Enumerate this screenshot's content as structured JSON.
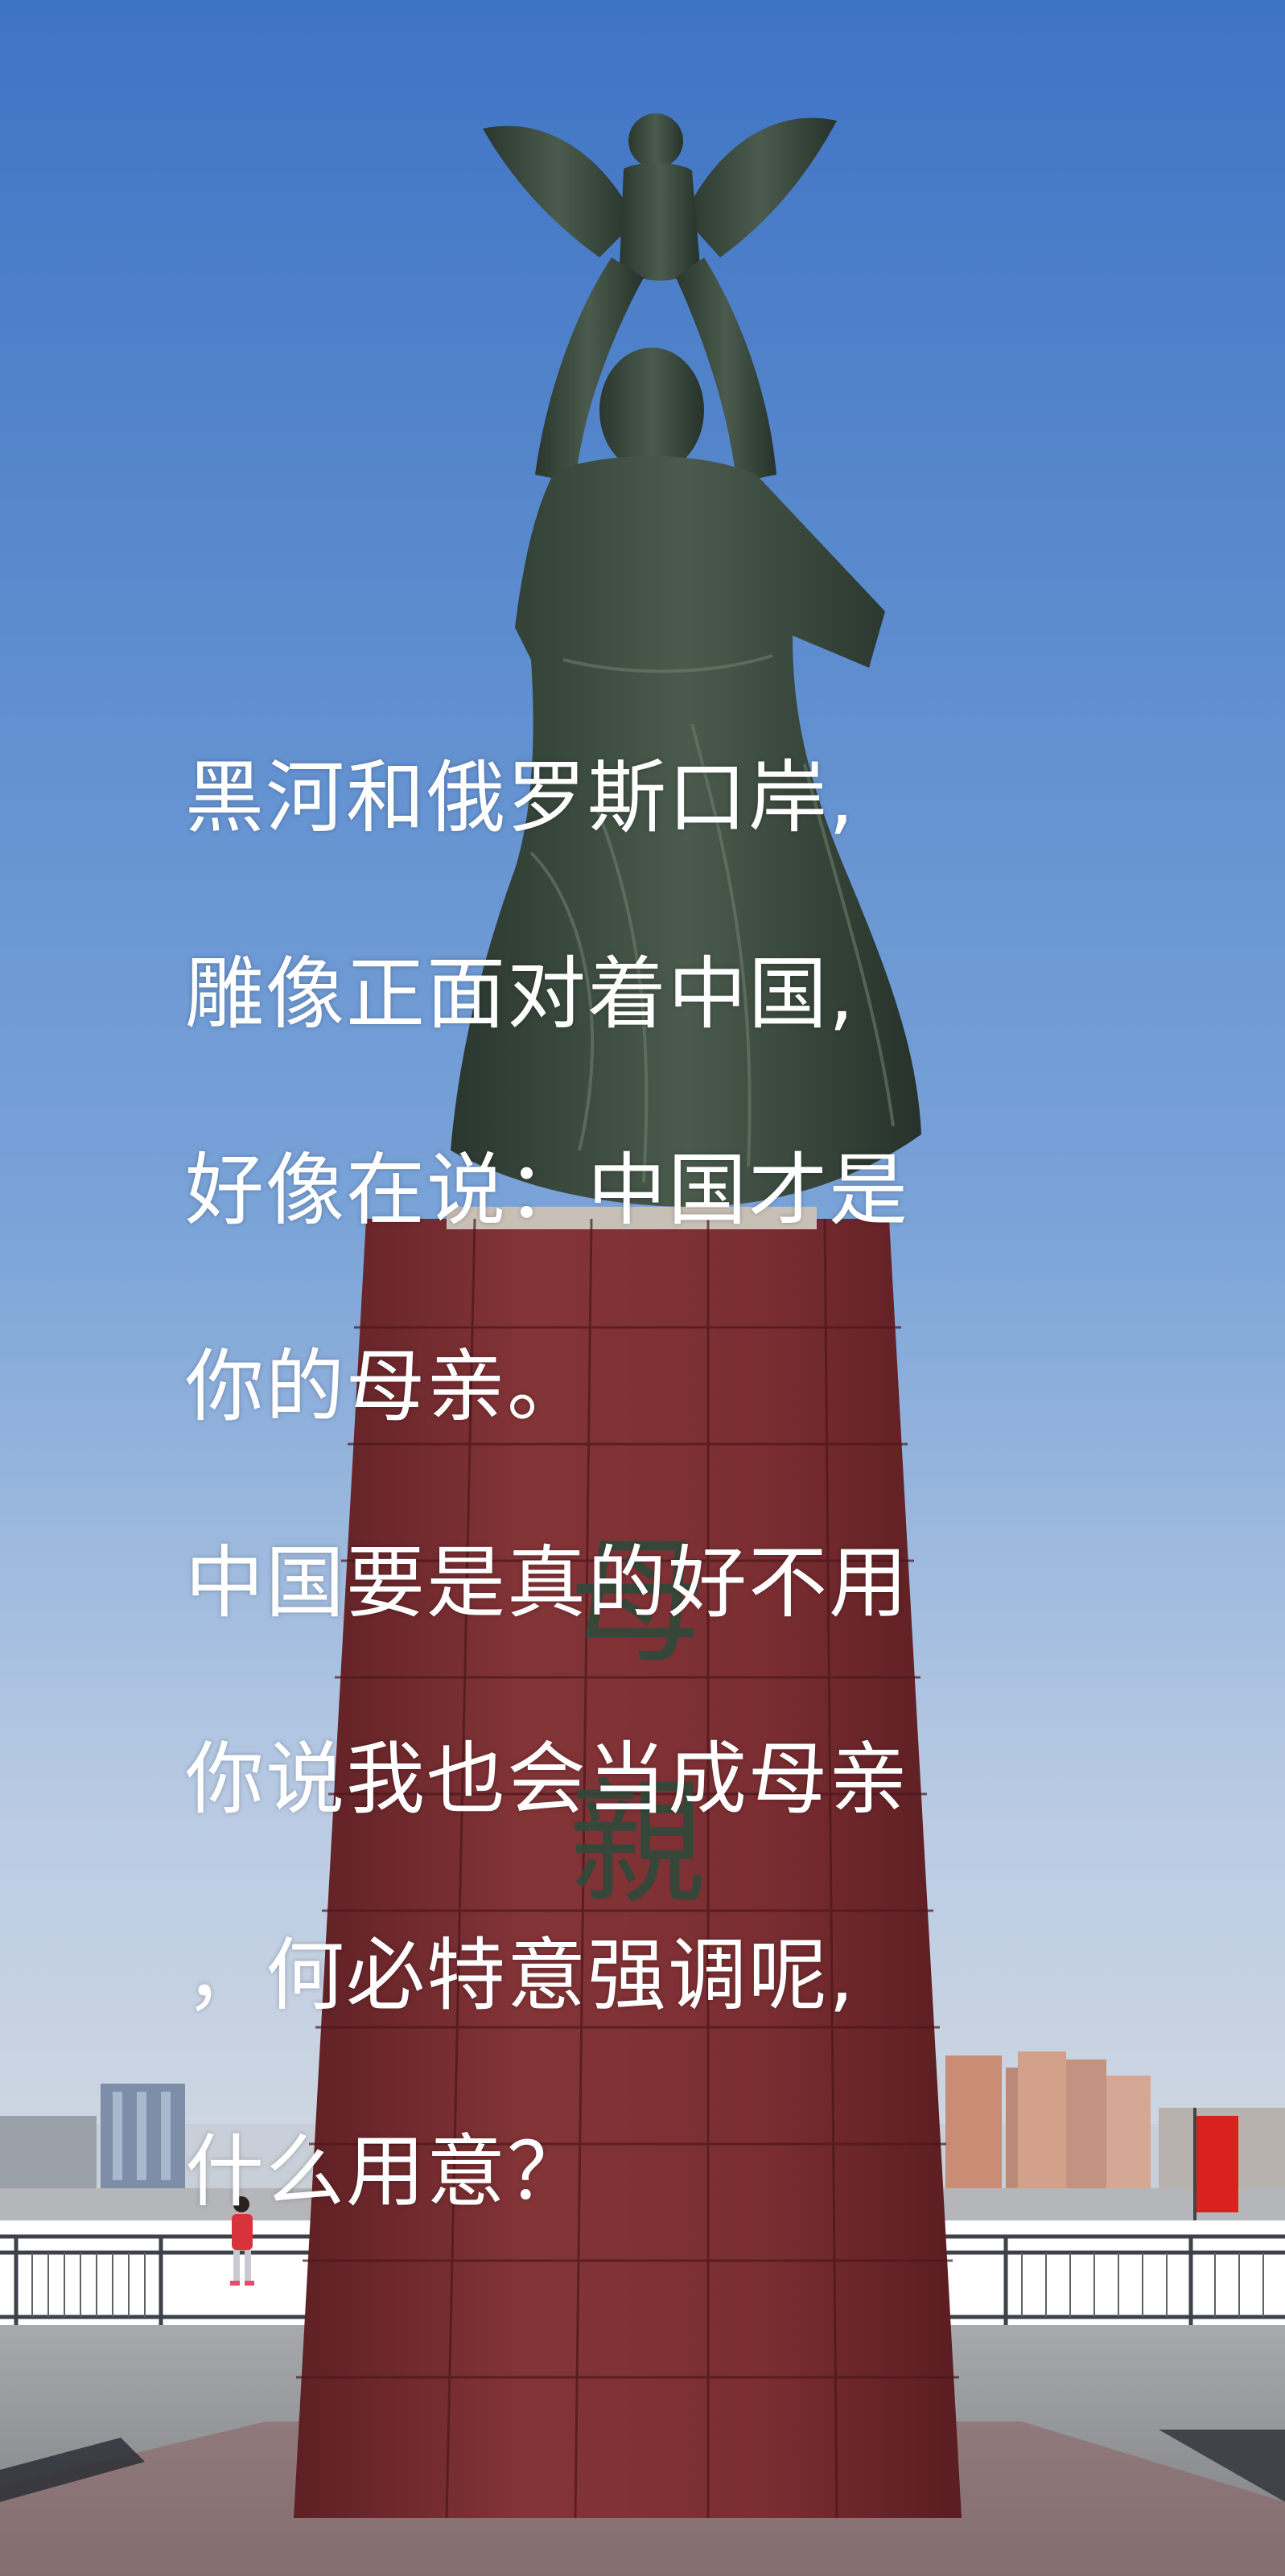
{
  "photo": {
    "subject": "monument",
    "sky_color": "#5f8fd0",
    "granite_color": "#7a2c30",
    "bronze_color": "#36463a",
    "plinth_inscription": [
      "母",
      "親"
    ]
  },
  "caption": {
    "lines": [
      "黑河和俄罗斯口岸,",
      "雕像正面对着中国,",
      "好像在说：中国才是",
      "你的母亲。",
      "中国要是真的好不用",
      "你说我也会当成母亲",
      "，何必特意强调呢,",
      "什么用意？"
    ]
  }
}
